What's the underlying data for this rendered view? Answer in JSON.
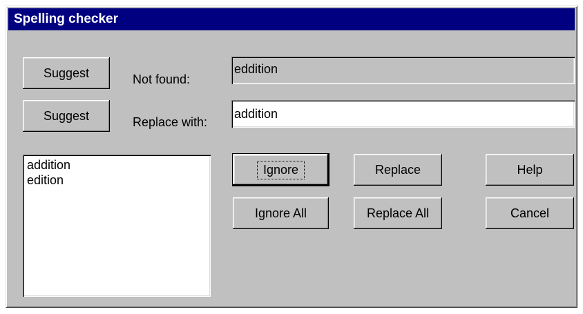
{
  "window": {
    "title": "Spelling checker"
  },
  "suggest_buttons": {
    "not_found_suggest_label": "Suggest",
    "replace_with_suggest_label": "Suggest"
  },
  "fields": {
    "not_found_label": "Not found:",
    "not_found_value": "eddition",
    "replace_with_label": "Replace with:",
    "replace_with_value": "addition"
  },
  "suggestions": {
    "items": [
      "addition",
      "edition"
    ]
  },
  "actions": {
    "ignore_label": "Ignore",
    "ignore_all_label": "Ignore All",
    "replace_label": "Replace",
    "replace_all_label": "Replace All",
    "help_label": "Help",
    "cancel_label": "Cancel"
  }
}
